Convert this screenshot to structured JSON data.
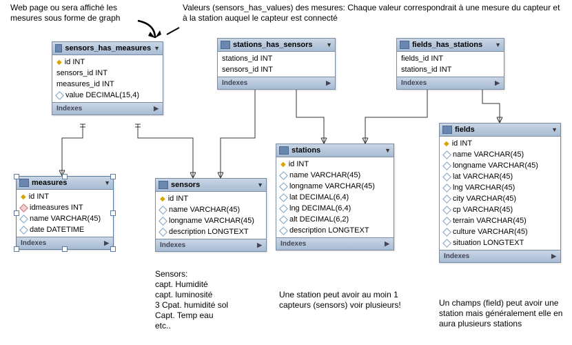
{
  "annotations": {
    "webpage": "Web page ou sera affiché les mesures sous forme de graph",
    "values": "Valeurs  (sensors_has_values) des mesures: Chaque valeur correspondrait à une mesure du capteur et à la station auquel  le capteur est connecté",
    "sensors_note": "Sensors:\ncapt. Humidité\ncapt. luminosité\n3 Cpat. humidité sol\nCapt. Temp eau\netc..",
    "station_note": "Une station peut avoir au moin 1 capteurs (sensors) voir plusieurs!",
    "field_note": "Un champs (field) peut avoir une station mais généralement elle en aura plusieurs stations"
  },
  "indexes_label": "Indexes",
  "tables": {
    "sensors_has_measures": {
      "title": "sensors_has_measures",
      "cols": [
        "id INT",
        "sensors_id INT",
        "measures_id INT",
        "value DECIMAL(15,4)"
      ],
      "pk": [
        0
      ],
      "diamond": [
        3
      ]
    },
    "stations_has_sensors": {
      "title": "stations_has_sensors",
      "cols": [
        "stations_id INT",
        "sensors_id INT"
      ]
    },
    "fields_has_stations": {
      "title": "fields_has_stations",
      "cols": [
        "fields_id INT",
        "stations_id INT"
      ]
    },
    "measures": {
      "title": "measures",
      "cols": [
        "id INT",
        "idmeasures INT",
        "name VARCHAR(45)",
        "date DATETIME"
      ],
      "pk": [
        0
      ],
      "rdiamond": [
        1
      ],
      "diamond": [
        2,
        3
      ]
    },
    "sensors": {
      "title": "sensors",
      "cols": [
        "id INT",
        "name VARCHAR(45)",
        "longname VARCHAR(45)",
        "description LONGTEXT"
      ],
      "pk": [
        0
      ],
      "diamond": [
        1,
        2,
        3
      ]
    },
    "stations": {
      "title": "stations",
      "cols": [
        "id INT",
        "name VARCHAR(45)",
        "longname VARCHAR(45)",
        "lat DECIMAL(6,4)",
        "lng DECIMAL(6,4)",
        "alt DECIMAL(6,2)",
        "description LONGTEXT"
      ],
      "pk": [
        0
      ],
      "diamond": [
        1,
        2,
        3,
        4,
        5,
        6
      ]
    },
    "fields": {
      "title": "fields",
      "cols": [
        "id INT",
        "name VARCHAR(45)",
        "longname VARCHAR(45)",
        "lat VARCHAR(45)",
        "lng VARCHAR(45)",
        "city VARCHAR(45)",
        "cp VARCHAR(45)",
        "terrain VARCHAR(45)",
        "culture VARCHAR(45)",
        "situation LONGTEXT"
      ],
      "pk": [
        0
      ],
      "diamond": [
        1,
        2,
        3,
        4,
        5,
        6,
        7,
        8,
        9
      ]
    }
  },
  "chart_data": {
    "type": "table",
    "description": "Entity-Relationship Diagram (MySQL Workbench style)",
    "entities": [
      {
        "name": "sensors_has_measures",
        "columns": [
          {
            "name": "id",
            "type": "INT",
            "pk": true
          },
          {
            "name": "sensors_id",
            "type": "INT"
          },
          {
            "name": "measures_id",
            "type": "INT"
          },
          {
            "name": "value",
            "type": "DECIMAL(15,4)"
          }
        ]
      },
      {
        "name": "stations_has_sensors",
        "columns": [
          {
            "name": "stations_id",
            "type": "INT"
          },
          {
            "name": "sensors_id",
            "type": "INT"
          }
        ]
      },
      {
        "name": "fields_has_stations",
        "columns": [
          {
            "name": "fields_id",
            "type": "INT"
          },
          {
            "name": "stations_id",
            "type": "INT"
          }
        ]
      },
      {
        "name": "measures",
        "columns": [
          {
            "name": "id",
            "type": "INT",
            "pk": true
          },
          {
            "name": "idmeasures",
            "type": "INT"
          },
          {
            "name": "name",
            "type": "VARCHAR(45)"
          },
          {
            "name": "date",
            "type": "DATETIME"
          }
        ]
      },
      {
        "name": "sensors",
        "columns": [
          {
            "name": "id",
            "type": "INT",
            "pk": true
          },
          {
            "name": "name",
            "type": "VARCHAR(45)"
          },
          {
            "name": "longname",
            "type": "VARCHAR(45)"
          },
          {
            "name": "description",
            "type": "LONGTEXT"
          }
        ]
      },
      {
        "name": "stations",
        "columns": [
          {
            "name": "id",
            "type": "INT",
            "pk": true
          },
          {
            "name": "name",
            "type": "VARCHAR(45)"
          },
          {
            "name": "longname",
            "type": "VARCHAR(45)"
          },
          {
            "name": "lat",
            "type": "DECIMAL(6,4)"
          },
          {
            "name": "lng",
            "type": "DECIMAL(6,4)"
          },
          {
            "name": "alt",
            "type": "DECIMAL(6,2)"
          },
          {
            "name": "description",
            "type": "LONGTEXT"
          }
        ]
      },
      {
        "name": "fields",
        "columns": [
          {
            "name": "id",
            "type": "INT",
            "pk": true
          },
          {
            "name": "name",
            "type": "VARCHAR(45)"
          },
          {
            "name": "longname",
            "type": "VARCHAR(45)"
          },
          {
            "name": "lat",
            "type": "VARCHAR(45)"
          },
          {
            "name": "lng",
            "type": "VARCHAR(45)"
          },
          {
            "name": "city",
            "type": "VARCHAR(45)"
          },
          {
            "name": "cp",
            "type": "VARCHAR(45)"
          },
          {
            "name": "terrain",
            "type": "VARCHAR(45)"
          },
          {
            "name": "culture",
            "type": "VARCHAR(45)"
          },
          {
            "name": "situation",
            "type": "LONGTEXT"
          }
        ]
      }
    ],
    "relationships": [
      {
        "from": "sensors_has_measures",
        "to": "measures"
      },
      {
        "from": "sensors_has_measures",
        "to": "sensors"
      },
      {
        "from": "stations_has_sensors",
        "to": "sensors"
      },
      {
        "from": "stations_has_sensors",
        "to": "stations"
      },
      {
        "from": "fields_has_stations",
        "to": "stations"
      },
      {
        "from": "fields_has_stations",
        "to": "fields"
      }
    ]
  }
}
